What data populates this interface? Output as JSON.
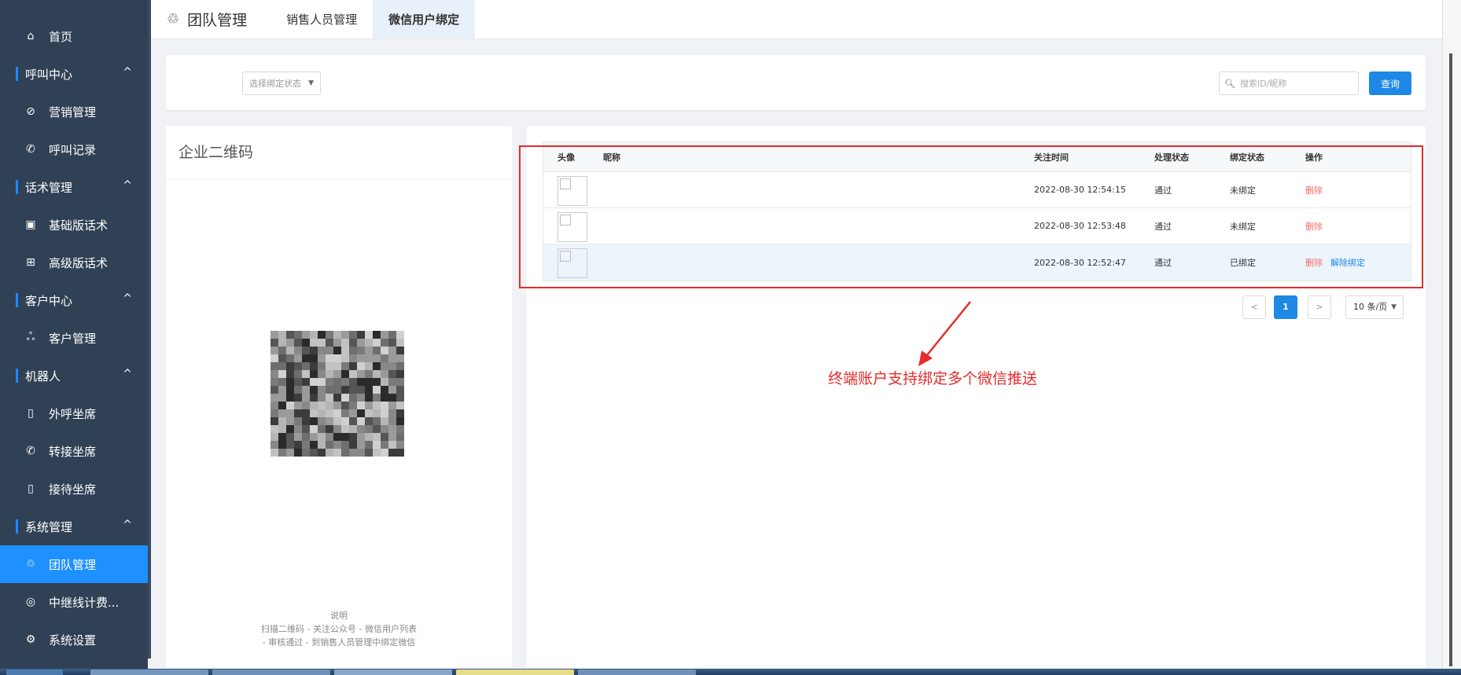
{
  "sidebar": {
    "home": "首页",
    "groups": [
      {
        "label": "呼叫中心",
        "items": [
          "营销管理",
          "呼叫记录"
        ]
      },
      {
        "label": "话术管理",
        "items": [
          "基础版话术",
          "高级版话术"
        ]
      },
      {
        "label": "客户中心",
        "items": [
          "客户管理"
        ]
      },
      {
        "label": "机器人",
        "items": [
          "外呼坐席",
          "转接坐席",
          "接待坐席"
        ]
      },
      {
        "label": "系统管理",
        "items": [
          "团队管理",
          "中继线计费...",
          "系统设置"
        ]
      }
    ],
    "chevron": "^"
  },
  "tabs": {
    "title": "团队管理",
    "items": [
      "销售人员管理",
      "微信用户绑定"
    ],
    "active_index": 1
  },
  "filter": {
    "select_placeholder": "选择绑定状态",
    "search_placeholder": "搜索ID/昵称",
    "query_label": "查询"
  },
  "qr_panel": {
    "title": "企业二维码",
    "note_title": "说明",
    "note_line1": "扫描二维码 - 关注公众号 - 微信用户列表",
    "note_line2": "- 审核通过 - 到销售人员管理中绑定微信"
  },
  "table": {
    "headers": {
      "avatar": "头像",
      "nickname": "昵称",
      "time": "关注时间",
      "process": "处理状态",
      "bind": "绑定状态",
      "op": "操作"
    },
    "rows": [
      {
        "nickname": "",
        "time": "2022-08-30 12:54:15",
        "process": "通过",
        "bind": "未绑定",
        "delete": "删除",
        "unbind": ""
      },
      {
        "nickname": "",
        "time": "2022-08-30 12:53:48",
        "process": "通过",
        "bind": "未绑定",
        "delete": "删除",
        "unbind": ""
      },
      {
        "nickname": "",
        "time": "2022-08-30 12:52:47",
        "process": "通过",
        "bind": "已绑定",
        "delete": "删除",
        "unbind": "解除绑定"
      }
    ]
  },
  "pagination": {
    "prev": "<",
    "current": "1",
    "next": ">",
    "page_size": "10 条/页"
  },
  "annotation": "终端账户支持绑定多个微信推送",
  "colors": {
    "sidebar_bg": "#304156",
    "accent": "#1e88e5",
    "danger": "#f56c6c",
    "annotation_red": "#e52b2b"
  }
}
